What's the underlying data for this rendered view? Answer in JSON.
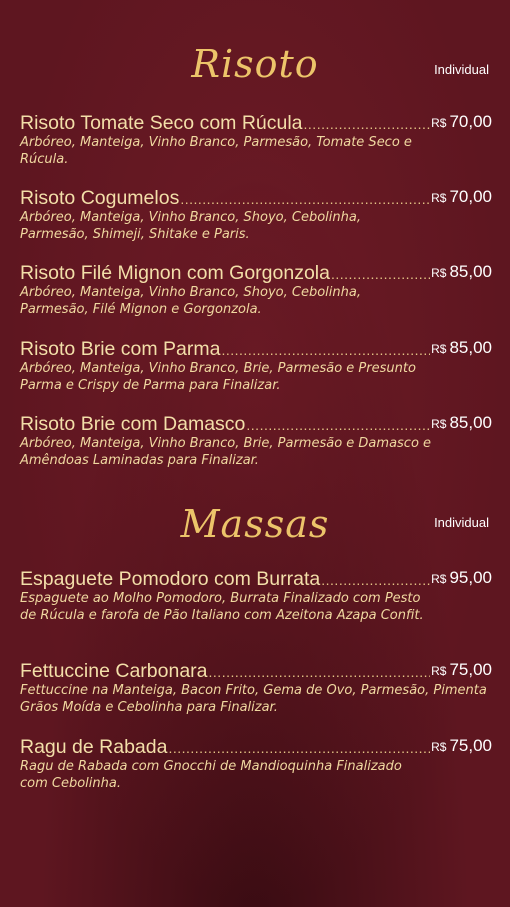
{
  "risoto": {
    "title": "Risoto",
    "portion": "Individual",
    "items": [
      {
        "name": "Risoto Tomate Seco com Rúcula",
        "currency": "R$",
        "price": "70,00",
        "desc": "Arbóreo, Manteiga, Vinho Branco, Parmesão, Tomate Seco e Rúcula."
      },
      {
        "name": "Risoto Cogumelos",
        "currency": "R$",
        "price": "70,00",
        "desc": "Arbóreo, Manteiga, Vinho Branco, Shoyo, Cebolinha, Parmesão, Shimeji, Shitake e Paris."
      },
      {
        "name": "Risoto Filé Mignon com Gorgonzola",
        "currency": "R$",
        "price": "85,00",
        "desc": "Arbóreo, Manteiga, Vinho Branco, Shoyo, Cebolinha, Parmesão, Filé Mignon e Gorgonzola."
      },
      {
        "name": "Risoto Brie com Parma",
        "currency": "R$",
        "price": "85,00",
        "desc": "Arbóreo, Manteiga, Vinho Branco, Brie, Parmesão e Presunto Parma e Crispy de Parma para Finalizar."
      },
      {
        "name": "Risoto Brie com Damasco",
        "currency": "R$",
        "price": "85,00",
        "desc": "Arbóreo, Manteiga, Vinho Branco, Brie, Parmesão e Damasco e Amêndoas Laminadas para Finalizar."
      }
    ]
  },
  "massas": {
    "title": "Massas",
    "portion": "Individual",
    "items": [
      {
        "name": "Espaguete Pomodoro com Burrata",
        "currency": "R$",
        "price": "95,00",
        "desc": "Espaguete ao Molho Pomodoro, Burrata Finalizado com Pesto de Rúcula e farofa de Pão Italiano com Azeitona Azapa Confit."
      },
      {
        "name": "Fettuccine Carbonara",
        "currency": "R$",
        "price": "75,00",
        "desc": "Fettuccine na Manteiga, Bacon Frito, Gema de Ovo, Parmesão, Pimenta Grãos Moída e Cebolinha para Finalizar."
      },
      {
        "name": "Ragu de Rabada",
        "currency": "R$",
        "price": "75,00",
        "desc": "Ragu de Rabada com Gnocchi de Mandioquinha Finalizado com Cebolinha."
      }
    ]
  }
}
